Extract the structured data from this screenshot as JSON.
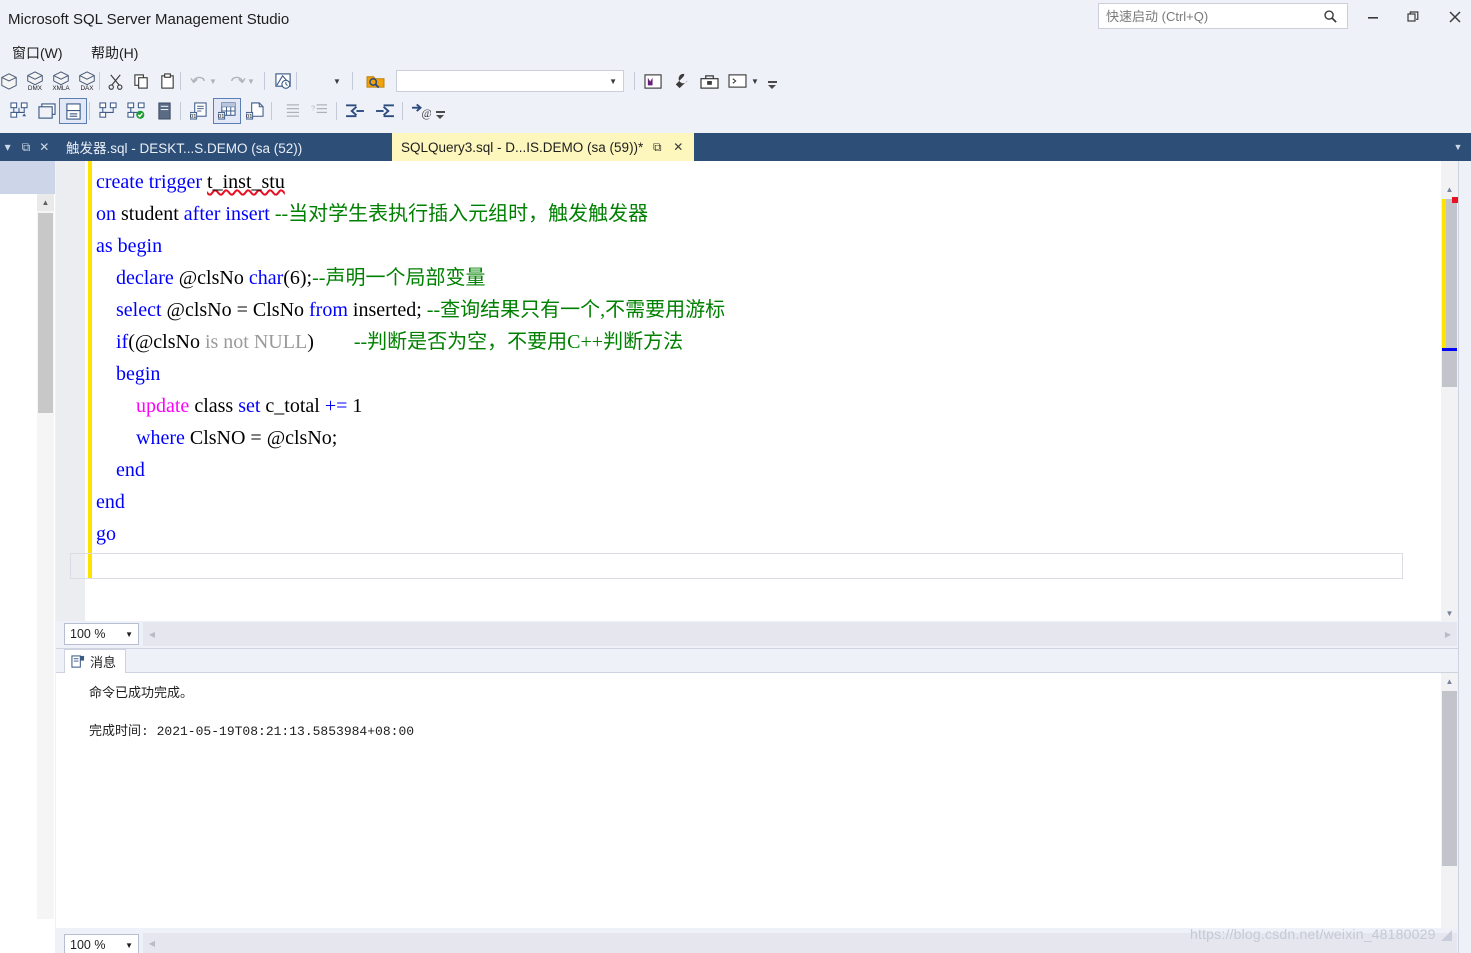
{
  "window": {
    "app_title": "Microsoft SQL Server Management Studio",
    "minimize_label": "—",
    "maximize_label": "❐",
    "close_label": "✕"
  },
  "quick_launch": {
    "placeholder": "快速启动 (Ctrl+Q)",
    "value": "",
    "icon": "search-icon"
  },
  "menu": {
    "items": [
      {
        "label": "窗口(W)"
      },
      {
        "label": "帮助(H)"
      }
    ]
  },
  "toolbar": {
    "database_combo": {
      "value": "",
      "arrow": "▼"
    },
    "row1_icons": [
      "new-query-icon",
      "new-dmx-query-icon",
      "new-xmla-query-icon",
      "new-dax-query-icon",
      "cut-icon",
      "copy-icon",
      "paste-icon",
      "undo-icon",
      "redo-icon",
      "execute-query-icon"
    ],
    "row2_icons": [
      "object-explorer-icon",
      "registered-servers-icon",
      "template-explorer-icon",
      "connect-icon",
      "connect-check-icon",
      "server-icon",
      "results-to-text-icon",
      "results-to-grid-icon",
      "results-to-file-icon",
      "indent-icon",
      "outdent-icon",
      "decrease-indent-icon",
      "increase-indent-icon",
      "specify-values-icon"
    ],
    "open-file-icon": "open-file-icon",
    "wrench-icon": "wrench-icon",
    "toolbox-icon": "toolbox-icon",
    "console-icon": "console-icon"
  },
  "tabs": [
    {
      "label": "触发器.sql - DESKT...S.DEMO (sa (52))",
      "active": false,
      "dirty": false
    },
    {
      "label": "SQLQuery3.sql - D...IS.DEMO (sa (59))*",
      "active": true,
      "dirty": true,
      "pin": "⧉",
      "close": "✕"
    }
  ],
  "left_dock": {
    "chevron": "▾",
    "pin": "⧉",
    "close": "✕"
  },
  "editor": {
    "zoom_level": "100 %",
    "zoom_arrow": "▼",
    "split_icon": "split-view-icon",
    "code_lines": [
      [
        {
          "t": "create trigger ",
          "c": "k"
        },
        {
          "t": "t_inst_stu",
          "c": "sq"
        }
      ],
      [
        {
          "t": "on",
          "c": "k"
        },
        {
          "t": " student ",
          "c": ""
        },
        {
          "t": "after",
          "c": "k"
        },
        {
          "t": " ",
          "c": ""
        },
        {
          "t": "insert",
          "c": "k"
        },
        {
          "t": " ",
          "c": ""
        },
        {
          "t": "--当对学生表执行插入元组时，触发触发器",
          "c": "cm"
        }
      ],
      [
        {
          "t": "as begin",
          "c": "k"
        }
      ],
      [
        {
          "t": "    ",
          "c": ""
        },
        {
          "t": "declare",
          "c": "k"
        },
        {
          "t": " @clsNo ",
          "c": ""
        },
        {
          "t": "char",
          "c": "k"
        },
        {
          "t": "(6);",
          "c": ""
        },
        {
          "t": "--声明一个局部变量",
          "c": "cm"
        }
      ],
      [
        {
          "t": "    ",
          "c": ""
        },
        {
          "t": "select",
          "c": "k"
        },
        {
          "t": " @clsNo = ClsNo ",
          "c": ""
        },
        {
          "t": "from",
          "c": "k"
        },
        {
          "t": " inserted; ",
          "c": ""
        },
        {
          "t": "--查询结果只有一个,不需要用游标",
          "c": "cm"
        }
      ],
      [
        {
          "t": "    ",
          "c": ""
        },
        {
          "t": "if",
          "c": "k"
        },
        {
          "t": "(@clsNo ",
          "c": ""
        },
        {
          "t": "is not NULL",
          "c": "gy"
        },
        {
          "t": ")        ",
          "c": ""
        },
        {
          "t": "--判断是否为空，不要用C++判断方法",
          "c": "cm"
        }
      ],
      [
        {
          "t": "    ",
          "c": ""
        },
        {
          "t": "begin",
          "c": "k"
        }
      ],
      [
        {
          "t": "        ",
          "c": ""
        },
        {
          "t": "update",
          "c": "kd"
        },
        {
          "t": " class ",
          "c": ""
        },
        {
          "t": "set",
          "c": "k"
        },
        {
          "t": " c_total ",
          "c": ""
        },
        {
          "t": "+=",
          "c": "k"
        },
        {
          "t": " 1",
          "c": ""
        }
      ],
      [
        {
          "t": "        ",
          "c": ""
        },
        {
          "t": "where",
          "c": "k"
        },
        {
          "t": " ClsNO = @clsNo;",
          "c": ""
        }
      ],
      [
        {
          "t": "    ",
          "c": ""
        },
        {
          "t": "end",
          "c": "k"
        }
      ],
      [
        {
          "t": "end",
          "c": "k"
        }
      ],
      [
        {
          "t": "go",
          "c": "k"
        }
      ]
    ]
  },
  "messages": {
    "tab_label": "消息",
    "tab_icon": "messages-icon",
    "lines": [
      "命令已成功完成。",
      "完成时间: 2021-05-19T08:21:13.5853984+08:00"
    ]
  },
  "status_bottom": {
    "zoom_level": "100 %",
    "zoom_arrow": "▼"
  },
  "watermark": "https://blog.csdn.net/weixin_48180029",
  "colors": {
    "keyword": "#0000ff",
    "dml_keyword": "#ff00ff",
    "comment": "#008000",
    "grayed": "#9a9a9a",
    "active_tab_bg": "#fdf6bd",
    "dock_bg": "#2d4e77",
    "chrome_bg": "#eef1f8",
    "change_bar": "#ffe300",
    "error_mark": "#e81123"
  }
}
